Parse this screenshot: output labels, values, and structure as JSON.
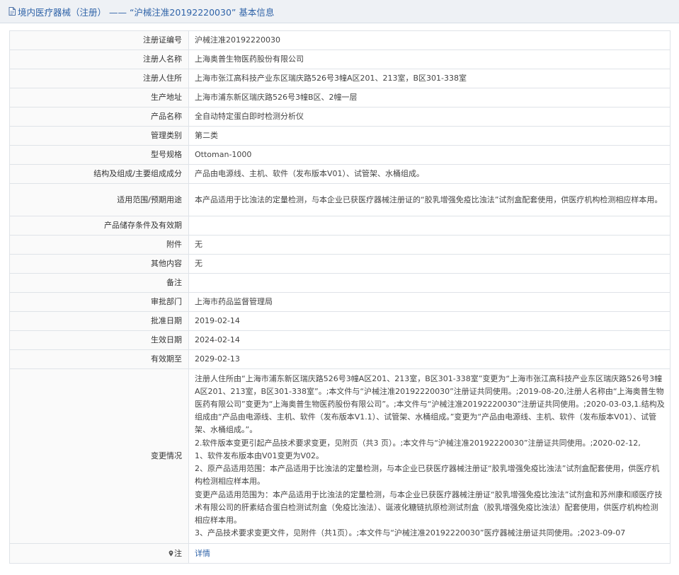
{
  "page": {
    "title": "境内医疗器械（注册） —— “沪械注准20192220030” 基本信息"
  },
  "rows": [
    {
      "label": "注册证编号",
      "value": "沪械注准20192220030"
    },
    {
      "label": "注册人名称",
      "value": "上海奥普生物医药股份有限公司"
    },
    {
      "label": "注册人住所",
      "value": "上海市张江高科技产业东区瑞庆路526号3幢A区201、213室，B区301-338室"
    },
    {
      "label": "生产地址",
      "value": "上海市浦东新区瑞庆路526号3幢B区、2幢一层"
    },
    {
      "label": "产品名称",
      "value": "全自动特定蛋白即时检测分析仪"
    },
    {
      "label": "管理类别",
      "value": "第二类"
    },
    {
      "label": "型号规格",
      "value": "Ottoman-1000"
    },
    {
      "label": "结构及组成/主要组成成分",
      "value": "产品由电源线、主机、软件（发布版本V01）、试管架、水桶组成。"
    },
    {
      "label": "适用范围/预期用途",
      "value": "本产品适用于比浊法的定量检测，与本企业已获医疗器械注册证的“胶乳增强免疫比浊法”试剂盒配套使用，供医疗机构检测相应样本用。"
    },
    {
      "label": "产品储存条件及有效期",
      "value": ""
    },
    {
      "label": "附件",
      "value": "无"
    },
    {
      "label": "其他内容",
      "value": "无"
    },
    {
      "label": "备注",
      "value": ""
    },
    {
      "label": "审批部门",
      "value": "上海市药品监督管理局"
    },
    {
      "label": "批准日期",
      "value": "2019-02-14"
    },
    {
      "label": "生效日期",
      "value": "2024-02-14"
    },
    {
      "label": "有效期至",
      "value": "2029-02-13"
    }
  ],
  "changes": {
    "label": "变更情况",
    "paragraphs": [
      "注册人住所由“上海市浦东新区瑞庆路526号3幢A区201、213室，B区301-338室”变更为“上海市张江高科技产业东区瑞庆路526号3幢A区201、213室，B区301-338室”。;本文件与“沪械注准20192220030”注册证共同使用。;2019-08-20,注册人名称由“上海奥普生物医药有限公司”变更为“上海奥普生物医药股份有限公司”。;本文件与“沪械注准20192220030”注册证共同使用。;2020-03-03,1.结构及组成由“产品由电源线、主机、软件（发布版本V1.1）、试管架、水桶组成。”变更为“产品由电源线、主机、软件（发布版本V01）、试管架、水桶组成。”。",
      "2.软件版本变更引起产品技术要求变更，见附页（共3 页）。;本文件与“沪械注准20192220030”注册证共同使用。;2020-02-12,",
      "1、软件发布版本由V01变更为V02。",
      "2、原产品适用范围：本产品适用于比浊法的定量检测，与本企业已获医疗器械注册证“胶乳增强免疫比浊法”试剂盒配套使用，供医疗机构检测相应样本用。",
      "变更产品适用范围为：本产品适用于比浊法的定量检测，与本企业已获医疗器械注册证“胶乳增强免疫比浊法”试剂盒和苏州康和顺医疗技术有限公司的肝素结合蛋白检测试剂盒（免疫比浊法）、诞液化糖链抗原检测试剂盒（胶乳增强免疫比浊法）配套使用，供医疗机构检测相应样本用。",
      "3、产品技术要求变更文件，见附件（共1页）。;本文件与“沪械注准20192220030”医疗器械注册证共同使用。;2023-09-07"
    ]
  },
  "note": {
    "label": "注",
    "link_text": "详情"
  },
  "icons": {
    "header": "document-icon",
    "note": "map-pin-icon"
  },
  "colors": {
    "link": "#2f63a8",
    "header_bg": "#eef1f5",
    "border": "#dfe3e8"
  }
}
